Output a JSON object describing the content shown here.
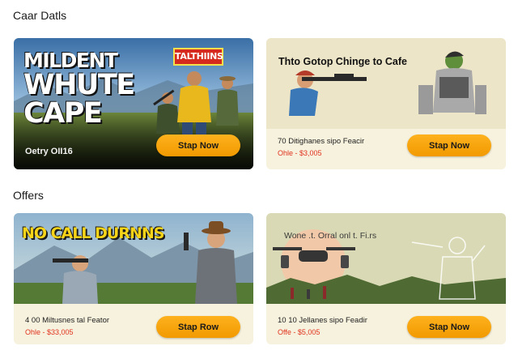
{
  "sections": [
    {
      "title": "Caar Datls"
    },
    {
      "title": "Offers"
    }
  ],
  "cards": [
    {
      "title_line1": "MILDENT",
      "title_line2": "WHUTE",
      "title_line3": "CAPE",
      "badge": "TALTHIINS",
      "caption": "Oetry OII16",
      "button": "Stap Now"
    },
    {
      "headline": "Thto Gotop Chinge to Cafe",
      "line": "70 Ditighanes sipo Feacir",
      "price": "Ohle - $3,005",
      "button": "Stap Now"
    },
    {
      "title": "NO CALL DURNNS",
      "line": "4 00 Miltusnes tal Feator",
      "price": "Ohle - $33,005",
      "button": "Stap Row"
    },
    {
      "overlay": "Wone .t.  Orral onl t. Fi.rs",
      "line": "10 10 Jellanes sipo Feadir",
      "price": "Offe - $5,005",
      "button": "Stap Now"
    }
  ],
  "colors": {
    "accent": "#f7a711",
    "price": "#e0321e",
    "card_light": "#f5f0da"
  }
}
